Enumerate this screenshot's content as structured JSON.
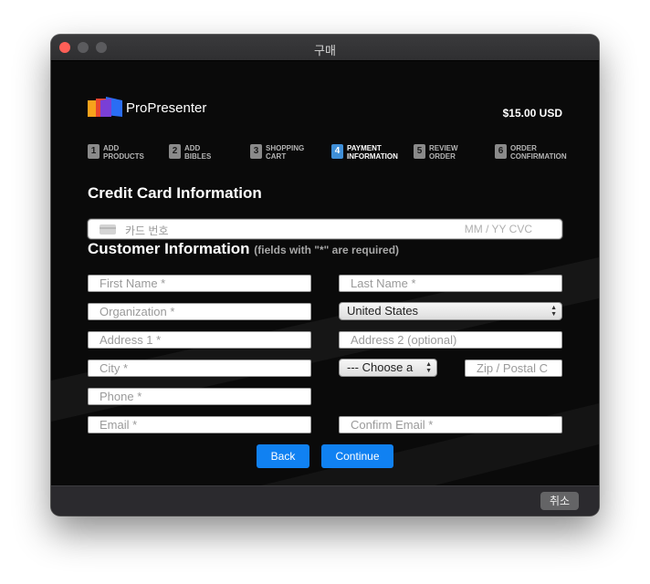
{
  "window": {
    "title": "구매"
  },
  "header": {
    "brand": "ProPresenter",
    "price": "$15.00 USD"
  },
  "steps": [
    {
      "num": "1",
      "label": "ADD\nPRODUCTS",
      "active": false
    },
    {
      "num": "2",
      "label": "ADD\nBIBLES",
      "active": false
    },
    {
      "num": "3",
      "label": "SHOPPING\nCART",
      "active": false
    },
    {
      "num": "4",
      "label": "PAYMENT\nINFORMATION",
      "active": true
    },
    {
      "num": "5",
      "label": "REVIEW\nORDER",
      "active": false
    },
    {
      "num": "6",
      "label": "ORDER\nCONFIRMATION",
      "active": false
    }
  ],
  "credit_card": {
    "title": "Credit Card Information",
    "number_placeholder": "카드 번호",
    "expiry_cvc_placeholder": "MM / YY  CVC"
  },
  "customer": {
    "title": "Customer Information",
    "note": "(fields with \"*\" are required)",
    "first_name": "First Name *",
    "last_name": "Last Name *",
    "organization": "Organization *",
    "country": "United States",
    "address1": "Address 1 *",
    "address2": "Address 2 (optional)",
    "city": "City *",
    "state": "--- Choose a",
    "zip": "Zip / Postal C",
    "phone": "Phone *",
    "email": "Email *",
    "confirm_email": "Confirm Email *"
  },
  "buttons": {
    "back": "Back",
    "continue": "Continue"
  },
  "footer": {
    "cancel": "취소"
  },
  "colors": {
    "accent": "#1081f2",
    "active_step": "#3f8fd8",
    "close": "#fe5f57"
  }
}
